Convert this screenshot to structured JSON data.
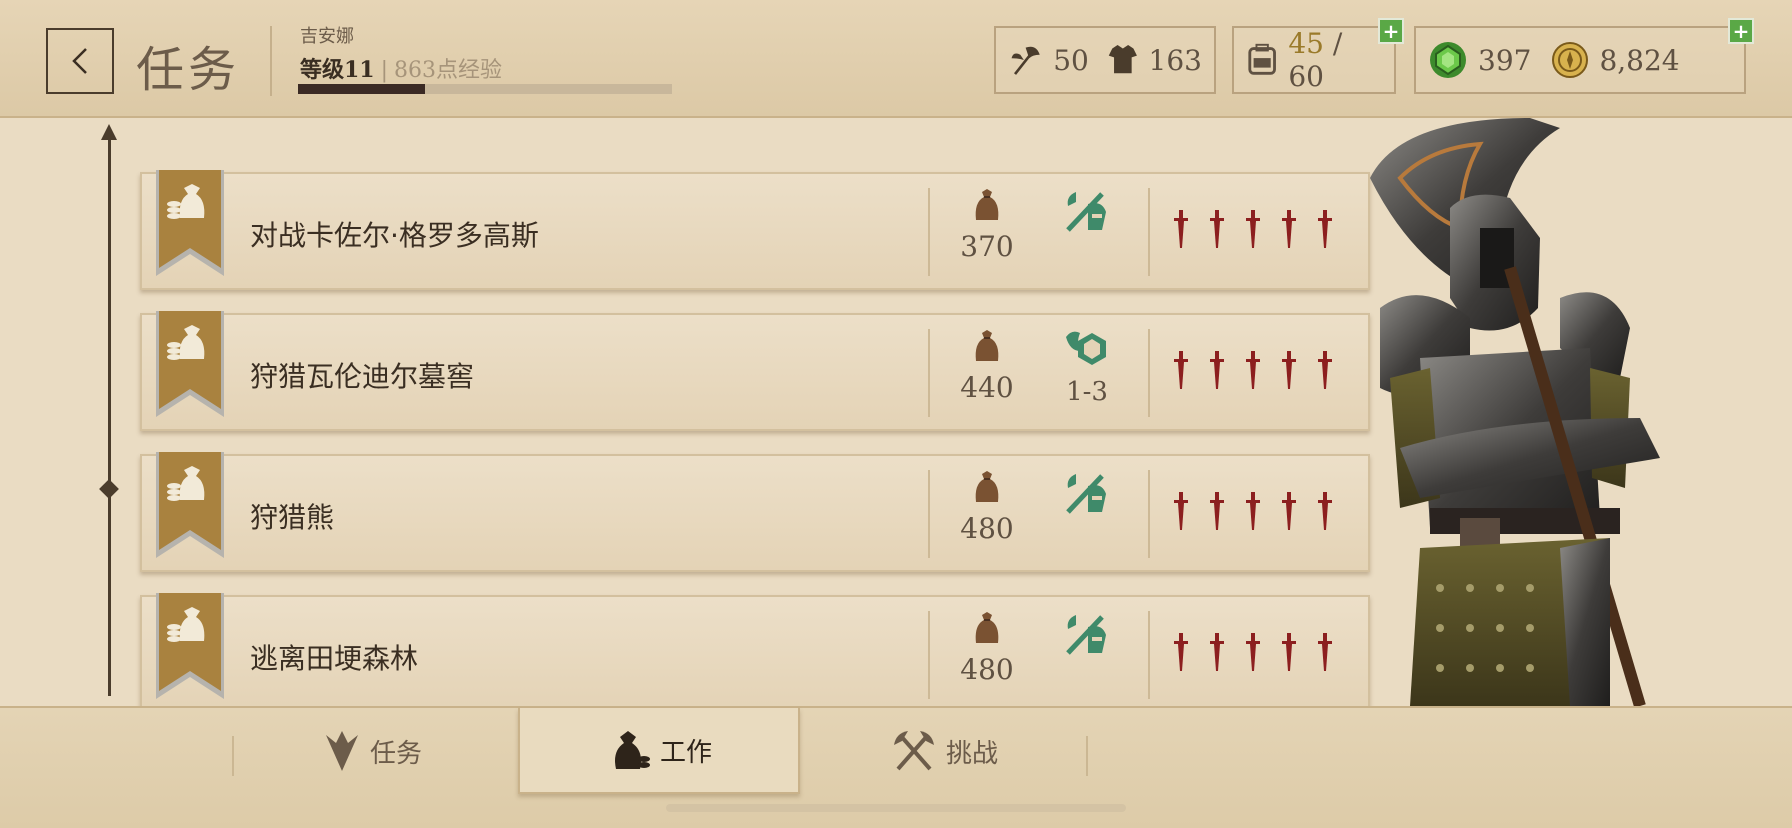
{
  "header": {
    "title": "任务",
    "player_name": "吉安娜",
    "level_label": "等级11",
    "level_separator": "|",
    "xp_label": "863点经验",
    "xp_progress": 0.34,
    "stats": {
      "attack": "50",
      "armor": "163",
      "inventory": {
        "current": "45",
        "separator": " / ",
        "max": "60"
      },
      "gems": "397",
      "gold": "8,824"
    }
  },
  "quests": [
    {
      "name": "对战卡佐尔·格罗多高斯",
      "reward_gold": "370",
      "type": "combat",
      "type_label": "",
      "difficulty": 5
    },
    {
      "name": "狩猎瓦伦迪尔墓窖",
      "reward_gold": "440",
      "type": "gem",
      "type_label": "1-3",
      "difficulty": 5
    },
    {
      "name": "狩猎熊",
      "reward_gold": "480",
      "type": "combat",
      "type_label": "",
      "difficulty": 5
    },
    {
      "name": "逃离田埂森林",
      "reward_gold": "480",
      "type": "combat",
      "type_label": "",
      "difficulty": 5
    }
  ],
  "tabs": [
    {
      "label": "任务",
      "icon": "quest-icon",
      "active": false
    },
    {
      "label": "工作",
      "icon": "money-bag-icon",
      "active": true
    },
    {
      "label": "挑战",
      "icon": "crossed-axes-icon",
      "active": false
    }
  ],
  "colors": {
    "accent_green": "#5aa846",
    "icon_teal": "#3f8a6a",
    "dagger_red": "#8c1f1f",
    "ribbon_brown": "#a9823f"
  }
}
